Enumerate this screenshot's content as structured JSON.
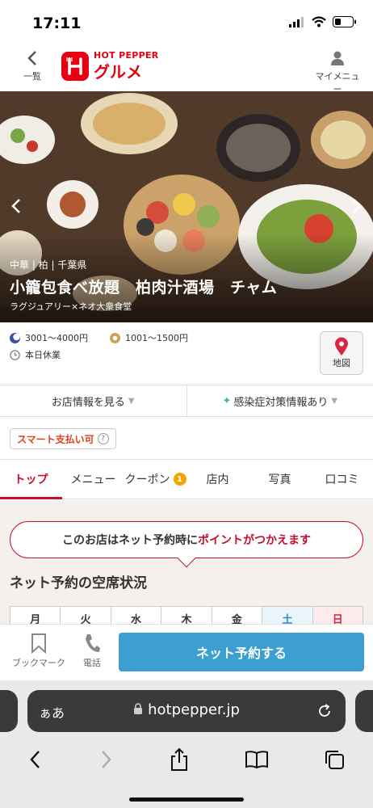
{
  "status_bar": {
    "time": "17:11"
  },
  "header": {
    "back_label": "一覧",
    "logo_top": "HOT PEPPER",
    "logo_bottom": "グルメ",
    "mymenu_label": "マイメニュー"
  },
  "hero": {
    "genre": "中華 | 柏 | 千葉県",
    "name": "小籠包食べ放題　柏肉汁酒場　チャム",
    "subtitle": "ラグジュアリー×ネオ大衆食堂"
  },
  "info": {
    "dinner_budget": "3001～4000円",
    "lunch_budget": "1001～1500円",
    "holiday": "本日休業",
    "map_label": "地図"
  },
  "buttons": {
    "shop_info": "お店情報を見る",
    "covid_info": "感染症対策情報あり"
  },
  "smart_pay": {
    "label": "スマート支払い可",
    "help": "?"
  },
  "tabs": [
    {
      "label": "トップ"
    },
    {
      "label": "メニュー"
    },
    {
      "label": "クーポン",
      "count": "1"
    },
    {
      "label": "店内"
    },
    {
      "label": "写真"
    },
    {
      "label": "口コミ"
    }
  ],
  "points_bubble": {
    "prefix": "このお店はネット予約時に",
    "highlight": "ポイントがつかえます"
  },
  "seat_section": {
    "title": "ネット予約の空席状況",
    "days": [
      "月",
      "火",
      "水",
      "木",
      "金",
      "土",
      "日"
    ]
  },
  "actions": {
    "bookmark_label": "ブックマーク",
    "phone_label": "電話",
    "reserve_label": "ネット予約する"
  },
  "browser": {
    "aa": "ぁあ",
    "url": "hotpepper.jp"
  },
  "colors": {
    "brand": "#e60012",
    "accent_red": "#c8102e",
    "reserve_blue": "#3d9fd1",
    "coupon_badge": "#f0a500"
  }
}
